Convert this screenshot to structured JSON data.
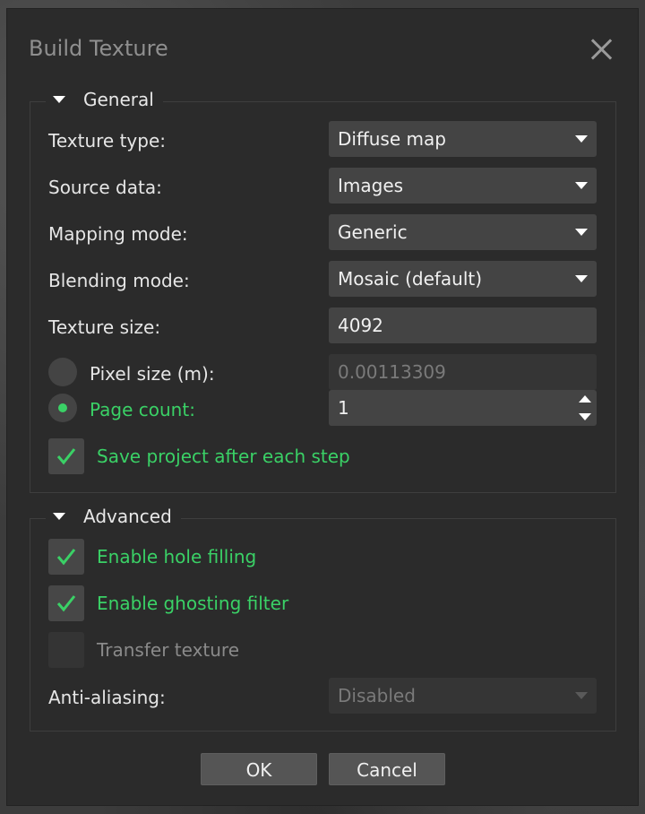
{
  "dialog": {
    "title": "Build Texture"
  },
  "general": {
    "title": "General",
    "texture_type": {
      "label": "Texture type:",
      "value": "Diffuse map"
    },
    "source_data": {
      "label": "Source data:",
      "value": "Images"
    },
    "mapping_mode": {
      "label": "Mapping mode:",
      "value": "Generic"
    },
    "blending_mode": {
      "label": "Blending mode:",
      "value": "Mosaic (default)"
    },
    "texture_size": {
      "label": "Texture size:",
      "value": "4092"
    },
    "pixel_size": {
      "label": "Pixel size (m):",
      "value": "0.00113309",
      "selected": false
    },
    "page_count": {
      "label": "Page count:",
      "value": "1",
      "selected": true
    },
    "save_project": {
      "label": "Save project after each step",
      "checked": true
    }
  },
  "advanced": {
    "title": "Advanced",
    "hole_filling": {
      "label": "Enable hole filling",
      "checked": true
    },
    "ghosting_filter": {
      "label": "Enable ghosting filter",
      "checked": true
    },
    "transfer_texture": {
      "label": "Transfer texture",
      "checked": false,
      "enabled": false
    },
    "anti_aliasing": {
      "label": "Anti-aliasing:",
      "value": "Disabled",
      "enabled": false
    }
  },
  "buttons": {
    "ok": "OK",
    "cancel": "Cancel"
  },
  "colors": {
    "accent": "#3ad166",
    "background": "#2b2b2b",
    "field": "#444444"
  }
}
